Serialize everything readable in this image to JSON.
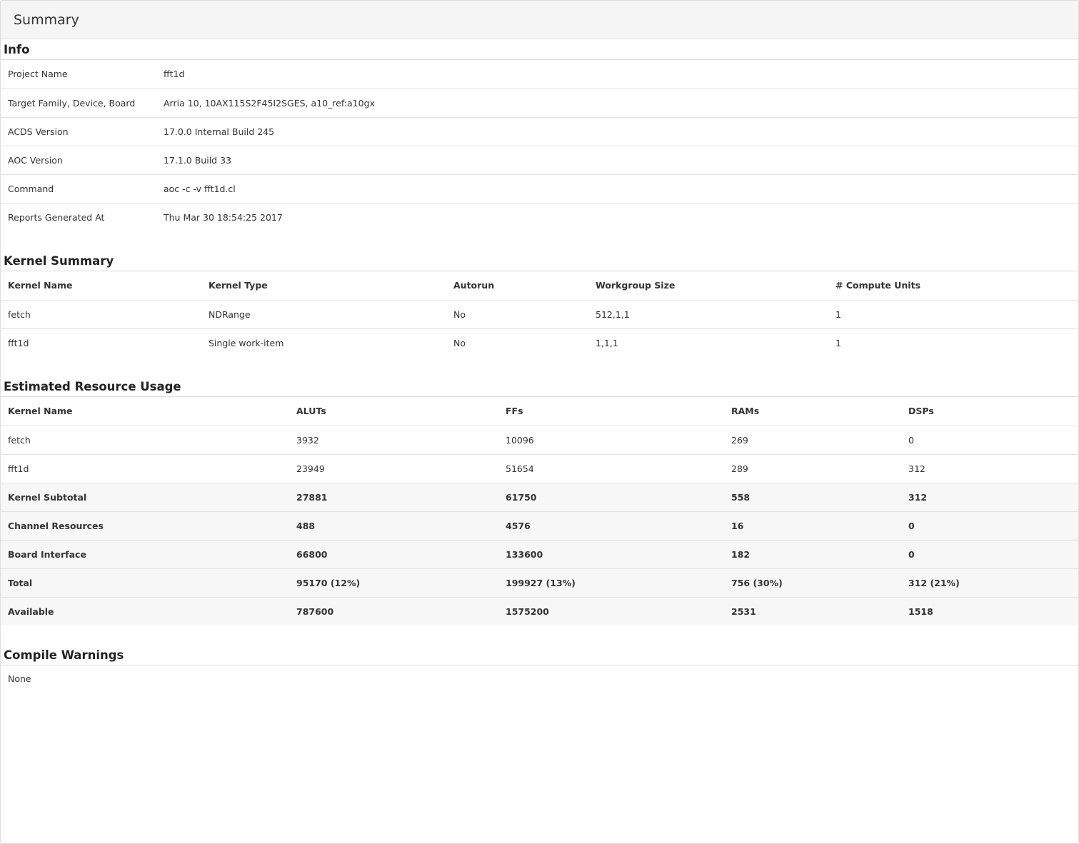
{
  "title": "Summary",
  "info": {
    "heading": "Info",
    "rows": [
      [
        "Project Name",
        "fft1d"
      ],
      [
        "Target Family, Device, Board",
        "Arria 10, 10AX115S2F45I2SGES, a10_ref:a10gx"
      ],
      [
        "ACDS Version",
        "17.0.0 Internal Build 245"
      ],
      [
        "AOC Version",
        "17.1.0 Build 33"
      ],
      [
        "Command",
        "aoc -c -v fft1d.cl"
      ],
      [
        "Reports Generated At",
        "Thu Mar 30 18:54:25 2017"
      ]
    ]
  },
  "kernel_summary": {
    "heading": "Kernel Summary",
    "columns": [
      "Kernel Name",
      "Kernel Type",
      "Autorun",
      "Workgroup Size",
      "# Compute Units"
    ],
    "rows": [
      [
        "fetch",
        "NDRange",
        "No",
        "512,1,1",
        "1"
      ],
      [
        "fft1d",
        "Single work-item",
        "No",
        "1,1,1",
        "1"
      ]
    ]
  },
  "resources": {
    "heading": "Estimated Resource Usage",
    "columns": [
      "Kernel Name",
      "ALUTs",
      "FFs",
      "RAMs",
      "DSPs"
    ],
    "rows": [
      [
        "fetch",
        "3932",
        "10096",
        "269",
        "0"
      ],
      [
        "fft1d",
        "23949",
        "51654",
        "289",
        "312"
      ]
    ],
    "summary_rows": [
      [
        "Kernel Subtotal",
        "27881",
        "61750",
        "558",
        "312"
      ],
      [
        "Channel Resources",
        "488",
        "4576",
        "16",
        "0"
      ],
      [
        "Board Interface",
        "66800",
        "133600",
        "182",
        "0"
      ],
      [
        "Total",
        "95170 (12%)",
        "199927 (13%)",
        "756 (30%)",
        "312 (21%)"
      ],
      [
        "Available",
        "787600",
        "1575200",
        "2531",
        "1518"
      ]
    ]
  },
  "warnings": {
    "heading": "Compile Warnings",
    "text": "None"
  }
}
